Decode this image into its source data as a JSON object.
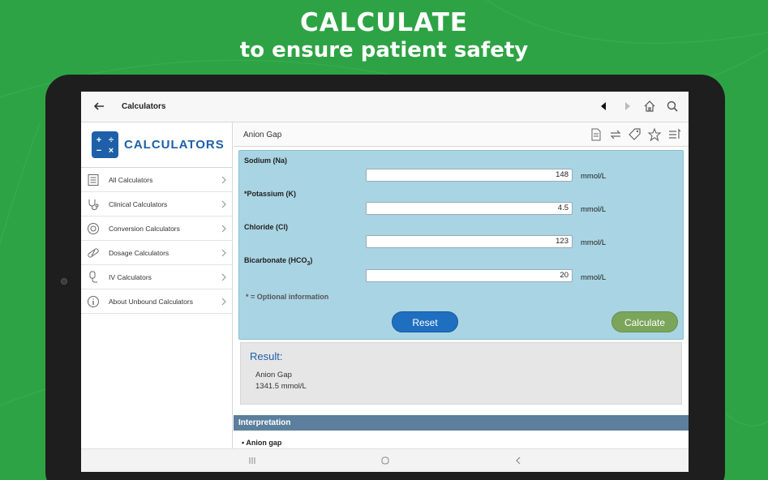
{
  "promo": {
    "headline": "CALCULATE",
    "subline": "to ensure patient safety"
  },
  "appbar": {
    "title": "Calculators",
    "icons": [
      "back-arrow-icon",
      "previous-icon",
      "next-icon",
      "home-icon",
      "search-icon"
    ]
  },
  "sidebar": {
    "logo_text": "CALCULATORS",
    "logo_glyphs": [
      "+",
      "÷",
      "−",
      "×"
    ],
    "items": [
      {
        "label": "All Calculators",
        "icon": "list-icon"
      },
      {
        "label": "Clinical Calculators",
        "icon": "stethoscope-icon"
      },
      {
        "label": "Conversion Calculators",
        "icon": "conversion-icon"
      },
      {
        "label": "Dosage Calculators",
        "icon": "pill-icon"
      },
      {
        "label": "IV Calculators",
        "icon": "iv-bag-icon"
      },
      {
        "label": "About Unbound Calculators",
        "icon": "info-icon"
      }
    ]
  },
  "calculator": {
    "title": "Anion Gap",
    "header_icons": [
      "note-icon",
      "exchange-icon",
      "tag-icon",
      "star-icon",
      "sort-icon"
    ],
    "fields": [
      {
        "label": "Sodium (Na)",
        "value": "148",
        "unit": "mmol/L"
      },
      {
        "label": "*Potassium (K)",
        "value": "4.5",
        "unit": "mmol/L"
      },
      {
        "label": "Chloride (Cl)",
        "value": "123",
        "unit": "mmol/L"
      },
      {
        "label_main": "Bicarbonate (HCO",
        "label_sub": "3",
        "label_end": ")",
        "value": "20",
        "unit": "mmol/L"
      }
    ],
    "note": "* = Optional information",
    "reset_label": "Reset",
    "calculate_label": "Calculate"
  },
  "result": {
    "title": "Result:",
    "name": "Anion Gap",
    "value": "1341.5 mmol/L"
  },
  "interpretation": {
    "title": "Interpretation",
    "first_item": "Anion gap"
  },
  "colors": {
    "background": "#2ea345",
    "brand_blue": "#1d5fa8",
    "form_panel": "#a9d4e3",
    "reset_button": "#1f6fc0",
    "calculate_button": "#7aa55a",
    "interpretation_bar": "#5b7f9c"
  }
}
